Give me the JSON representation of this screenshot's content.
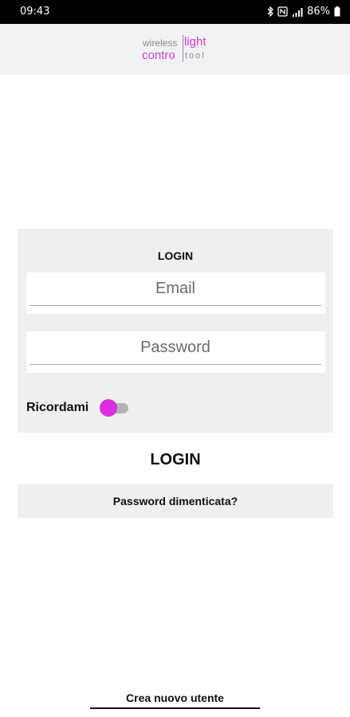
{
  "status_bar": {
    "time": "09:43",
    "battery": "86%",
    "icons": [
      "bluetooth-icon",
      "nfc-icon",
      "signal-icon",
      "battery-icon"
    ]
  },
  "logo": {
    "word_wireless": "wireless",
    "word_light": "light",
    "word_contro": "contro",
    "word_tool": "tool"
  },
  "login_card": {
    "title": "LOGIN",
    "email_placeholder": "Email",
    "password_placeholder": "Password",
    "remember_label": "Ricordami",
    "remember_on": true
  },
  "actions": {
    "login_label": "LOGIN",
    "forgot_label": "Password dimenticata?",
    "create_user_label": "Crea nuovo utente"
  },
  "colors": {
    "accent": "#d92fdc",
    "card_bg": "#efefef",
    "header_bg": "#f1f2f4"
  }
}
